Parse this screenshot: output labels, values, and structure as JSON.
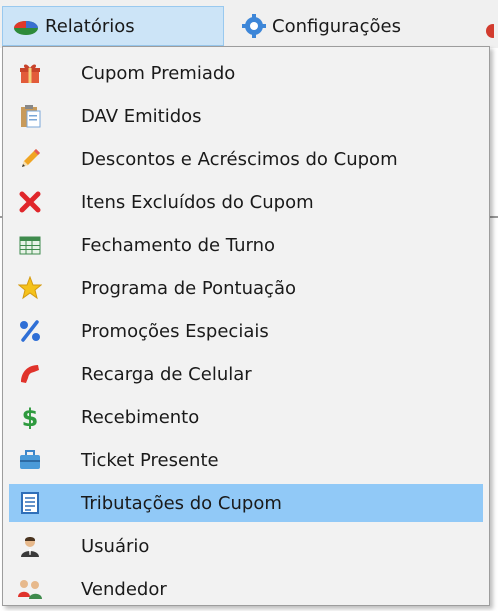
{
  "menubar": {
    "reports_label": "Relatórios",
    "settings_label": "Configurações"
  },
  "menu": {
    "items": [
      {
        "label": "Cupom Premiado",
        "icon": "gift-icon"
      },
      {
        "label": "DAV Emitidos",
        "icon": "clipboard-icon"
      },
      {
        "label": "Descontos e Acréscimos do Cupom",
        "icon": "pencil-icon"
      },
      {
        "label": "Itens Excluídos do Cupom",
        "icon": "red-x-icon"
      },
      {
        "label": "Fechamento de Turno",
        "icon": "spreadsheet-icon"
      },
      {
        "label": "Programa de Pontuação",
        "icon": "star-icon"
      },
      {
        "label": "Promoções Especiais",
        "icon": "percent-icon"
      },
      {
        "label": "Recarga de Celular",
        "icon": "phone-handset-icon"
      },
      {
        "label": "Recebimento",
        "icon": "dollar-icon"
      },
      {
        "label": "Ticket Presente",
        "icon": "toolbox-icon"
      },
      {
        "label": "Tributações do Cupom",
        "icon": "document-icon",
        "selected": true
      },
      {
        "label": "Usuário",
        "icon": "user-icon"
      },
      {
        "label": "Vendedor",
        "icon": "users-icon"
      }
    ]
  },
  "colors": {
    "highlight": "#91c9f7",
    "menubar_active": "#cce4f7"
  }
}
